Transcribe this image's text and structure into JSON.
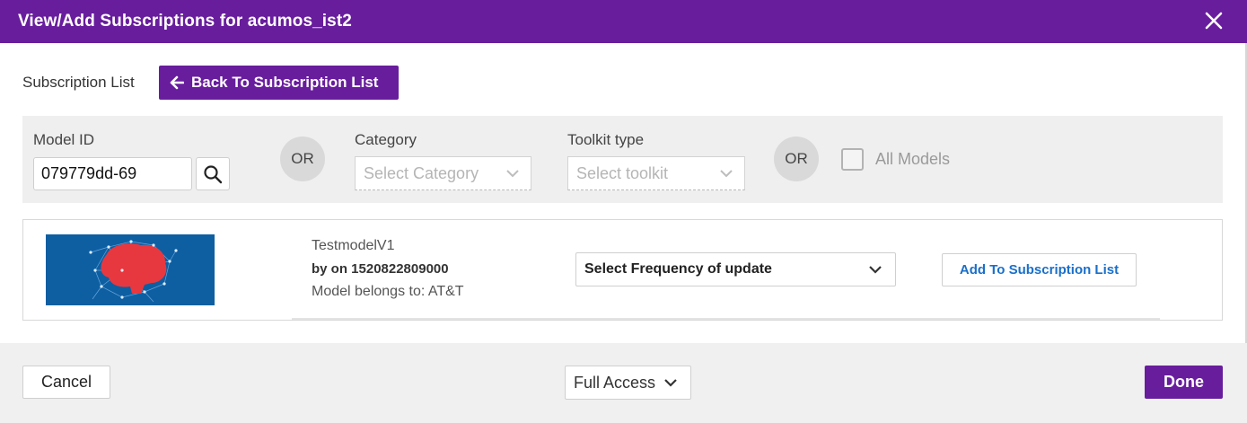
{
  "dialog": {
    "title": "View/Add Subscriptions for acumos_ist2"
  },
  "subscription": {
    "label": "Subscription List",
    "back_button": "Back To Subscription List"
  },
  "filters": {
    "model_id_label": "Model ID",
    "model_id_value": "079779dd-69",
    "or_text": "OR",
    "category_label": "Category",
    "category_placeholder": "Select Category",
    "toolkit_label": "Toolkit type",
    "toolkit_placeholder": "Select toolkit",
    "all_models_label": "All Models",
    "all_models_checked": false
  },
  "result": {
    "model_name": "TestmodelV1",
    "by_line": "by on 1520822809000",
    "belongs": "Model belongs to: AT&T",
    "frequency_placeholder": "Select Frequency of update",
    "add_button": "Add To Subscription List"
  },
  "footer": {
    "cancel": "Cancel",
    "access": "Full Access",
    "done": "Done"
  },
  "colors": {
    "brand": "#681d9d",
    "link": "#1a6fc9",
    "image_bg": "#0d5fa2",
    "brain": "#e8383f"
  },
  "icons": [
    "close-icon",
    "arrow-left-icon",
    "search-icon",
    "chevron-down-icon",
    "brain-network-icon"
  ]
}
